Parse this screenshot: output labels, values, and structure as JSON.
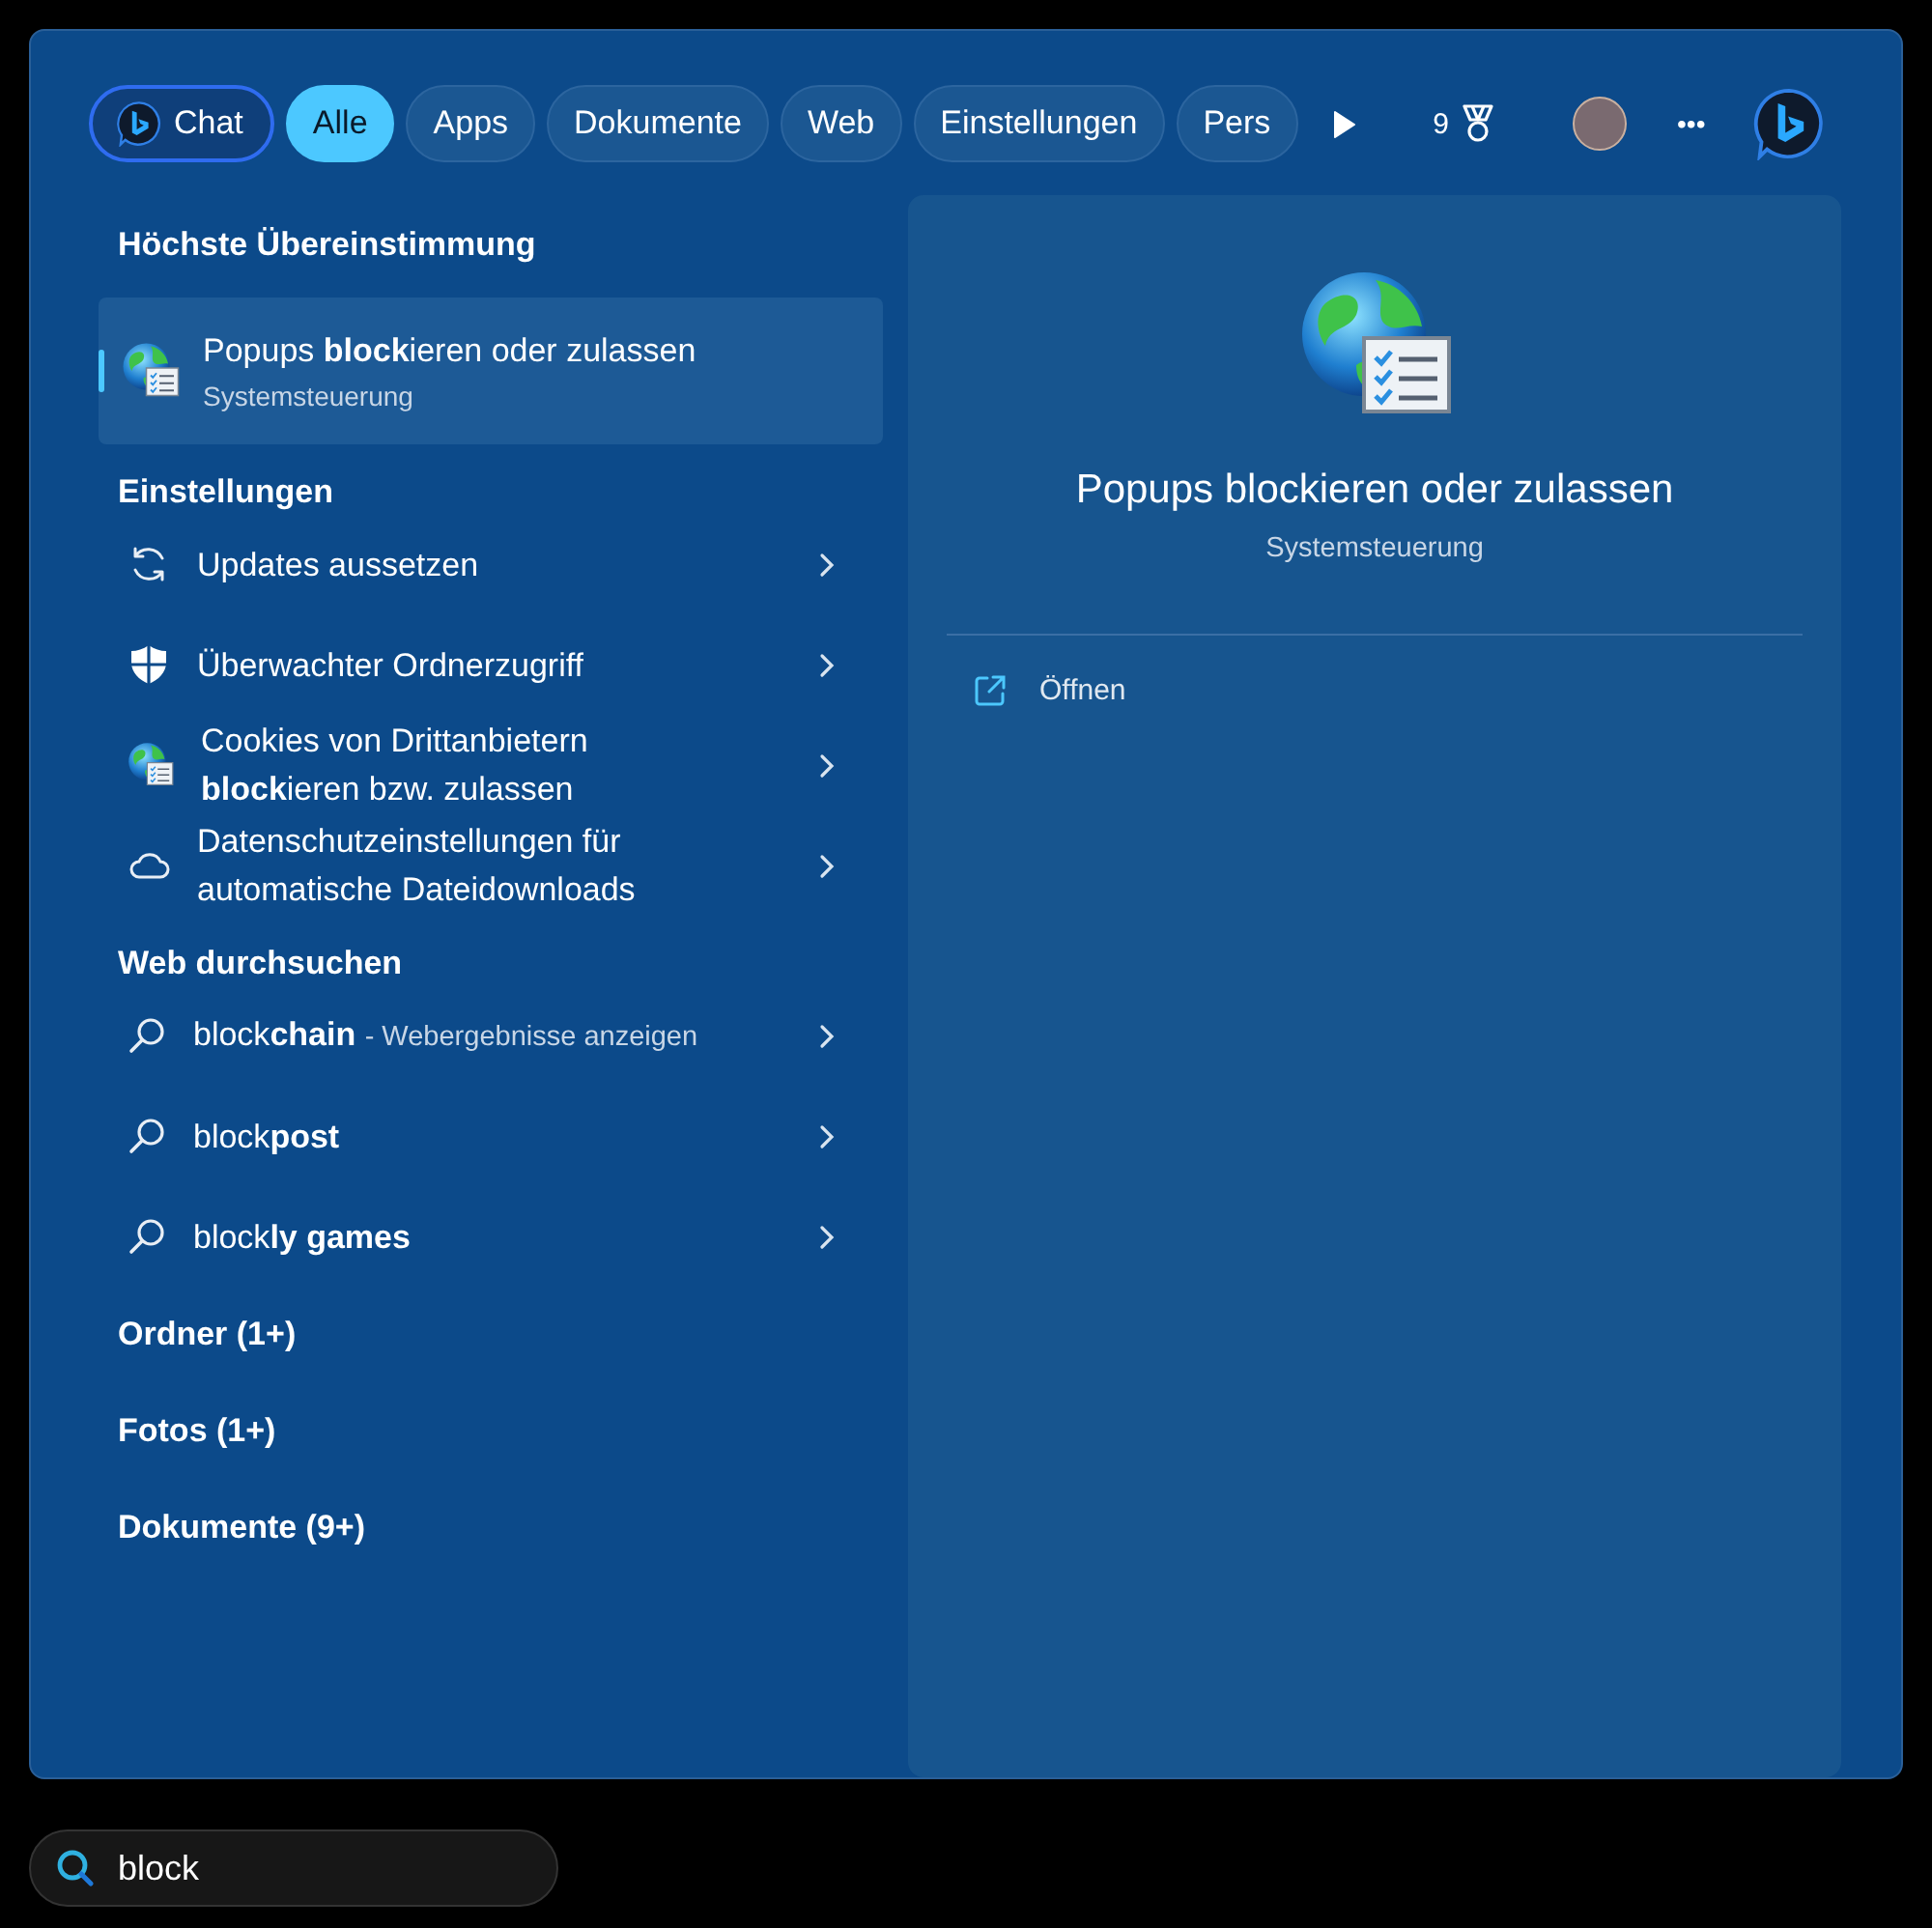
{
  "filters": [
    {
      "label": "Chat",
      "selected": false,
      "focused": true,
      "kind": "chat"
    },
    {
      "label": "Alle",
      "selected": true,
      "focused": false,
      "kind": "plain"
    },
    {
      "label": "Apps",
      "selected": false,
      "focused": false,
      "kind": "plain"
    },
    {
      "label": "Dokumente",
      "selected": false,
      "focused": false,
      "kind": "plain"
    },
    {
      "label": "Web",
      "selected": false,
      "focused": false,
      "kind": "plain"
    },
    {
      "label": "Einstellungen",
      "selected": false,
      "focused": false,
      "kind": "plain"
    },
    {
      "label": "Pers",
      "selected": false,
      "focused": false,
      "kind": "plain"
    }
  ],
  "rewards": {
    "points": "9"
  },
  "more_button": {
    "label": "•••"
  },
  "best_match": {
    "heading": "Höchste Übereinstimmung",
    "title": "Popups **block**ieren oder zulassen",
    "subtitle": "Systemsteuerung",
    "selected": true
  },
  "settings": {
    "heading": "Einstellungen",
    "items": [
      {
        "title": "Updates aussetzen"
      },
      {
        "title": "Überwachter Ordnerzugriff"
      },
      {
        "title": "Cookies von Drittanbietern **block**ieren bzw. zulassen"
      },
      {
        "title": "Datenschutzeinstellungen für automatische Dateidownloads"
      }
    ]
  },
  "web": {
    "heading": "Web durchsuchen",
    "items": [
      {
        "query": "block**chain**",
        "hint": "- Webergebnisse anzeigen"
      },
      {
        "query": "block**post**"
      },
      {
        "query": "block**ly games**"
      }
    ]
  },
  "categories": [
    "Ordner (1+)",
    "Fotos (1+)",
    "Dokumente (9+)"
  ],
  "preview": {
    "title": "Popups blockieren oder zulassen",
    "subtitle": "Systemsteuerung",
    "actions": [
      {
        "label": "Öffnen"
      }
    ]
  },
  "search": {
    "value": "block"
  }
}
